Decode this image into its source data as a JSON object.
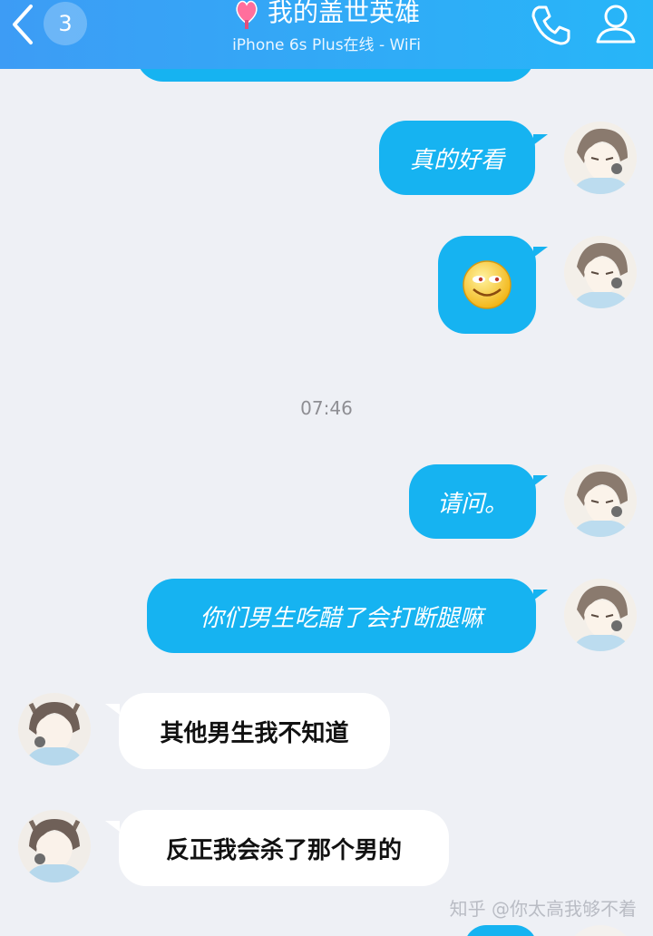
{
  "header": {
    "unread_count": "3",
    "title": "我的盖世英雄",
    "subtitle": "iPhone 6s Plus在线 - WiFi",
    "icons": [
      "back-chevron-icon",
      "heart-pin-icon",
      "phone-icon",
      "profile-icon"
    ]
  },
  "messages": [
    {
      "from": "me",
      "text": "真的好看"
    },
    {
      "from": "me",
      "emoji": "smiley-emoji-icon"
    },
    {
      "from": "me",
      "text": "请问。"
    },
    {
      "from": "me",
      "text": "你们男生吃醋了会打断腿嘛"
    },
    {
      "from": "them",
      "text": "其他男生我不知道"
    },
    {
      "from": "them",
      "text": "反正我会杀了那个男的"
    }
  ],
  "timestamp": "07:46",
  "watermark": "知乎 @你太高我够不着",
  "colors": {
    "header_start": "#3d9cf5",
    "header_end": "#27b6f8",
    "outgoing_bubble": "#16b3f1",
    "incoming_bubble": "#ffffff",
    "background": "#eef0f5"
  }
}
